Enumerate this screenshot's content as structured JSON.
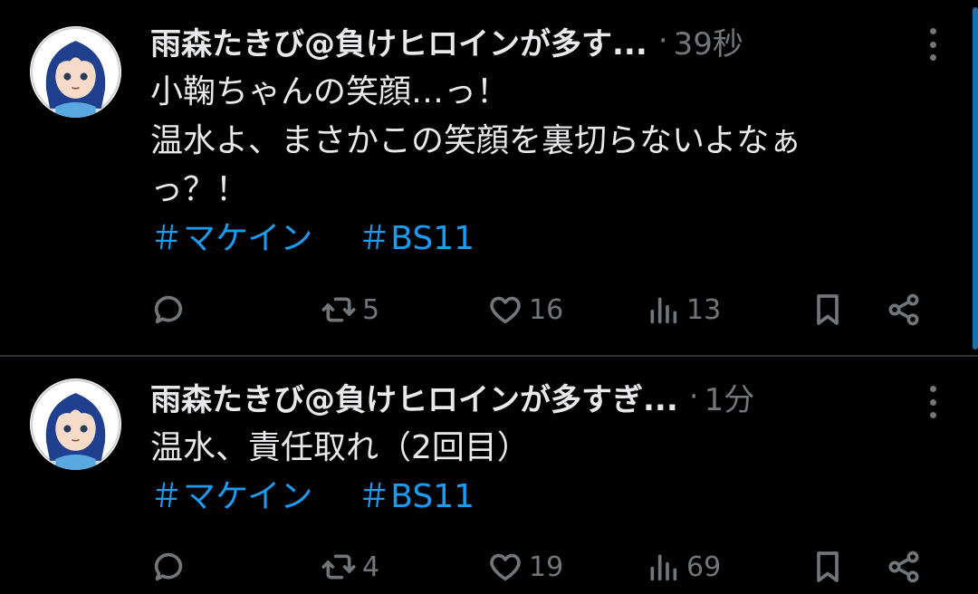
{
  "tweets": [
    {
      "author_name": "雨森たきび@負けヒロインが多す...",
      "separator": "·",
      "time": "39秒",
      "lines": [
        "小鞠ちゃんの笑顔…っ！",
        "温水よ、まさかこの笑顔を裏切らないよなぁ",
        "っ？！"
      ],
      "hashtags": [
        "＃マケイン",
        "＃BS11"
      ],
      "retweets": "5",
      "likes": "16",
      "views": "13",
      "icons": [
        "reply-icon",
        "retweet-icon",
        "like-icon",
        "views-icon",
        "bookmark-icon",
        "share-icon",
        "more-icon"
      ]
    },
    {
      "author_name": "雨森たきび@負けヒロインが多すぎ...",
      "separator": "·",
      "time": "1分",
      "lines": [
        "温水、責任取れ（2回目）"
      ],
      "hashtags": [
        "＃マケイン",
        "＃BS11"
      ],
      "retweets": "4",
      "likes": "19",
      "views": "69",
      "icons": [
        "reply-icon",
        "retweet-icon",
        "like-icon",
        "views-icon",
        "bookmark-icon",
        "share-icon",
        "more-icon"
      ]
    }
  ],
  "colors": {
    "background": "#000000",
    "text": "#e7e9ea",
    "muted": "#71767b",
    "link": "#1d9bf0",
    "divider": "#2f3336"
  }
}
